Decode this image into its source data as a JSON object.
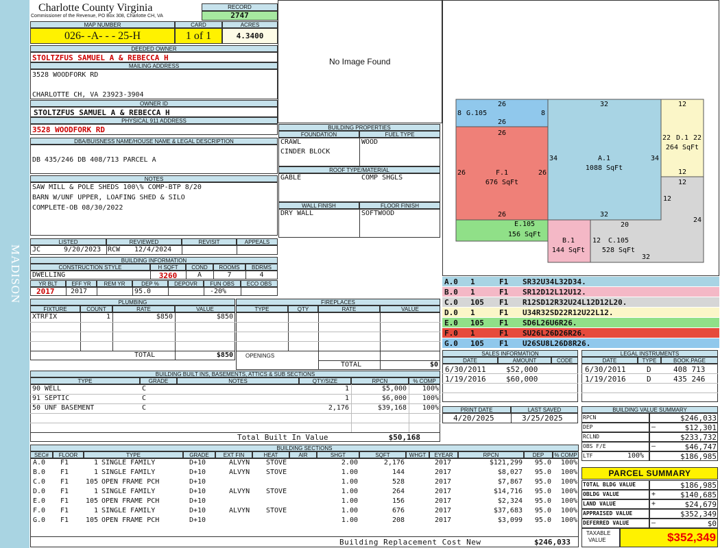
{
  "side_label": "MADISON",
  "header": {
    "county": "Charlotte County Virginia",
    "commissioner": "Commissioner of the Revenue, PO Box 308, Charlotte CH, VA",
    "record_label": "RECORD",
    "record": "2747"
  },
  "parcel": {
    "map_label": "MAP NUMBER",
    "map_number": "026- -A- - - 25-H",
    "card_label": "CARD",
    "card": "1 of 1",
    "acres_label": "ACRES",
    "acres": "4.3400"
  },
  "deeded_owner": {
    "label": "DEEDED OWNER",
    "value": "STOLTZFUS SAMUEL A & REBECCA H"
  },
  "mailing": {
    "label": "MAILING ADDRESS",
    "line1": "3528 WOODFORK RD",
    "line2": "CHARLOTTE CH, VA 23923-3904"
  },
  "owner_id": {
    "label": "OWNER ID",
    "value": "STOLTZFUS SAMUEL A & REBECCA H"
  },
  "physical": {
    "label": "PHYSICAL 911 ADDRESS",
    "value": "3528 WOODFORK RD"
  },
  "legal_desc": {
    "label": "DBA/BUISNESS NAME/HOUSE NAME & LEGAL DESCRIPTION",
    "value": "DB 435/246 DB 408/713 PARCEL A"
  },
  "notes": {
    "label": "NOTES",
    "lines": [
      "SAW MILL & POLE SHEDS 100\\% COMP-BTP 8/20",
      "BARN W/UNF UPPER, LOAFING SHED & SILO",
      "COMPLETE-OB 08/30/2022"
    ]
  },
  "image": {
    "no_image": "No Image Found"
  },
  "review": {
    "listed_label": "LISTED",
    "reviewed_label": "REVIEWED",
    "revisit_label": "REVISIT",
    "appeals_label": "APPEALS",
    "listed_by": "JC",
    "listed_date": "9/20/2023",
    "reviewed_by": "RCW",
    "reviewed_date": "12/4/2024"
  },
  "building_info": {
    "label": "BUILDING INFORMATION",
    "style_label": "CONSTRUCTION STYLE",
    "hsqft_label": "H SQFT",
    "cond_label": "COND",
    "rooms_label": "ROOMS",
    "bdrms_label": "BDRMS",
    "style": "DWELLING",
    "hsqft": "3260",
    "cond": "A",
    "rooms": "7",
    "bdrms": "4",
    "yrblt_label": "YR BLT",
    "effyr_label": "EFF YR",
    "remyr_label": "REM YR",
    "dep_label": "DEP %",
    "depovr_label": "DEPOVR",
    "funobs_label": "FUN OBS",
    "ecoobs_label": "ECO OBS",
    "yrblt": "2017",
    "effyr": "2017",
    "dep": "95.0",
    "funobs": "-20%"
  },
  "plumbing": {
    "label": "PLUMBING",
    "headers": [
      "FIXTURE",
      "COUNT",
      "RATE",
      "VALUE"
    ],
    "rows": [
      {
        "fixture": "XTRFIX",
        "count": "1",
        "rate": "$850",
        "value": "$850"
      }
    ],
    "total_label": "TOTAL",
    "total": "$850"
  },
  "fireplaces": {
    "label": "FIREPLACES",
    "headers": [
      "TYPE",
      "QTY",
      "RATE",
      "VALUE"
    ],
    "openings_label": "OPENINGS",
    "total_label": "TOTAL",
    "total": "$0"
  },
  "building_props": {
    "label": "BUILDING PROPERTIES",
    "foundation_label": "FOUNDATION",
    "fuel_label": "FUEL TYPE",
    "foundation": [
      "CRAWL",
      "CINDER BLOCK"
    ],
    "fuel": "WOOD",
    "roof_label": "ROOF TYPE/MATERIAL",
    "roof_type": "GABLE",
    "roof_material": "COMP SHGLS",
    "wall_label": "WALL FINISH",
    "floor_label": "FLOOR FINISH",
    "wall": "DRY WALL",
    "floor": "SOFTWOOD"
  },
  "sketch": {
    "areas": [
      {
        "id": "G",
        "name": "G.105",
        "sqft": "",
        "top": "26",
        "bottom": "26",
        "left": "8",
        "right": "8",
        "color": "#90c8ec"
      },
      {
        "id": "F",
        "name": "F.1",
        "sqft": "676 SqFt",
        "top": "26",
        "bottom": "26",
        "left": "26",
        "right": "26",
        "color": "#ef8078"
      },
      {
        "id": "A",
        "name": "A.1",
        "sqft": "1088 SqFt",
        "top": "32",
        "bottom": "32",
        "left": "34",
        "right": "34",
        "color": "#a8d4e4"
      },
      {
        "id": "D",
        "name": "D.1",
        "sqft": "264 SqFt",
        "top": "12",
        "bottom": "12",
        "left": "22",
        "right": "22",
        "color": "#fbf6c8"
      },
      {
        "id": "E",
        "name": "E.105",
        "sqft": "156 SqFt",
        "color": "#90e088"
      },
      {
        "id": "B",
        "name": "B.1",
        "sqft": "144 SqFt",
        "color": "#f4b8c6"
      },
      {
        "id": "C",
        "name": "C.105",
        "sqft": "528 SqFt",
        "t1": "12",
        "t2": "20",
        "l1": "12",
        "r1": "24",
        "b1": "12",
        "b2": "32",
        "color": "#d6d6d6"
      }
    ]
  },
  "vectors": [
    {
      "code": "A.0",
      "n": "1",
      "f": "F1",
      "path": "SR32U34L32D34.",
      "color": "#a8d4e4"
    },
    {
      "code": "B.0",
      "n": "1",
      "f": "F1",
      "path": "SR12D12L12U12.",
      "color": "#f4b8c6"
    },
    {
      "code": "C.0",
      "n": "105",
      "f": "F1",
      "path": "R12SD12R32U24L12D12L20.",
      "color": "#d6d6d6"
    },
    {
      "code": "D.0",
      "n": "1",
      "f": "F1",
      "path": "U34R32SD22R12U22L12.",
      "color": "#fbf6c8"
    },
    {
      "code": "E.0",
      "n": "105",
      "f": "F1",
      "path": "SD6L26U6R26.",
      "color": "#90e088"
    },
    {
      "code": "F.0",
      "n": "1",
      "f": "F1",
      "path": "SU26L26D26R26.",
      "color": "#e64a3c"
    },
    {
      "code": "G.0",
      "n": "105",
      "f": "F1",
      "path": "U26SU8L26D8R26.",
      "color": "#90c8ec"
    }
  ],
  "sales": {
    "label": "SALES INFORMATION",
    "headers": [
      "DATE",
      "AMOUNT",
      "CODE"
    ],
    "rows": [
      {
        "date": "6/30/2011",
        "amount": "$52,000"
      },
      {
        "date": "1/19/2016",
        "amount": "$60,000"
      }
    ]
  },
  "legal_instruments": {
    "label": "LEGAL INSTRUMENTS",
    "headers": [
      "DATE",
      "TYPE",
      "BOOK.PAGE"
    ],
    "rows": [
      {
        "date": "6/30/2011",
        "type": "D",
        "book": "408 713"
      },
      {
        "date": "1/19/2016",
        "type": "D",
        "book": "435 246"
      }
    ]
  },
  "print": {
    "print_label": "PRINT DATE",
    "saved_label": "LAST SAVED",
    "print_date": "4/20/2025",
    "last_saved": "3/25/2025"
  },
  "value_summary": {
    "label": "BUILDING VALUE SUMMARY",
    "rows": [
      {
        "label": "RPCN",
        "sign": "",
        "value": "$246,033"
      },
      {
        "label": "DEP",
        "sign": "–",
        "value": "$12,301"
      },
      {
        "label": "RCLND",
        "sign": "",
        "value": "$233,732"
      },
      {
        "label": "OBS F/E",
        "sign": "–",
        "value": "$46,747"
      },
      {
        "label": "LTF",
        "pct": "100%",
        "sign": "",
        "value": "$186,985"
      }
    ]
  },
  "parcel_summary": {
    "label": "PARCEL SUMMARY",
    "rows": [
      {
        "label": "TOTAL BLDG VALUE",
        "sign": "",
        "value": "$186,985"
      },
      {
        "label": "OBLDG VALUE",
        "sign": "+",
        "value": "$140,685"
      },
      {
        "label": "LAND VALUE",
        "sign": "+",
        "value": "$24,679"
      },
      {
        "label": "APPRAISED VALUE",
        "sign": "",
        "value": "$352,349"
      },
      {
        "label": "DEFERRED VALUE",
        "sign": "–",
        "value": "$0"
      }
    ],
    "taxable_label1": "TAXABLE",
    "taxable_label2": "VALUE",
    "taxable": "$352,349"
  },
  "builtins": {
    "label": "BUILDING BUILT INS, BASEMENTS, ATTICS & SUB SECTIONS",
    "headers": [
      "TYPE",
      "GRADE",
      "NOTES",
      "QTY/SIZE",
      "RPCN",
      "% COMP"
    ],
    "rows": [
      {
        "type": "90 WELL",
        "grade": "C",
        "qty": "1",
        "rpcn": "$5,000",
        "comp": "100%"
      },
      {
        "type": "91 SEPTIC",
        "grade": "C",
        "qty": "1",
        "rpcn": "$6,000",
        "comp": "100%"
      },
      {
        "type": "50 UNF BASEMENT",
        "grade": "C",
        "qty": "2,176",
        "rpcn": "$39,168",
        "comp": "100%"
      }
    ],
    "total_label": "Total Built In Value",
    "total": "$50,168"
  },
  "sections": {
    "label": "BUILDING SECTIONS",
    "headers": [
      "SEC#",
      "FLOOR",
      "TYPE",
      "GRADE",
      "EXT FIN",
      "HEAT",
      "AIR",
      "SHGT",
      "SQFT",
      "WHGT",
      "EYEAR",
      "RPCN",
      "DEP",
      "% COMP"
    ],
    "rows": [
      {
        "sec": "A.0",
        "floor": "F1",
        "code": "1",
        "type": "SINGLE FAMILY",
        "grade": "D+10",
        "ext": "ALVYN",
        "heat": "STOVE",
        "shgt": "2.00",
        "sqft": "2,176",
        "eyear": "2017",
        "rpcn": "$121,299",
        "dep": "95.0",
        "comp": "100%"
      },
      {
        "sec": "B.0",
        "floor": "F1",
        "code": "1",
        "type": "SINGLE FAMILY",
        "grade": "D+10",
        "ext": "ALVYN",
        "heat": "STOVE",
        "shgt": "1.00",
        "sqft": "144",
        "eyear": "2017",
        "rpcn": "$8,027",
        "dep": "95.0",
        "comp": "100%"
      },
      {
        "sec": "C.0",
        "floor": "F1",
        "code": "105",
        "type": "OPEN FRAME PCH",
        "grade": "D+10",
        "ext": "",
        "heat": "",
        "shgt": "1.00",
        "sqft": "528",
        "eyear": "2017",
        "rpcn": "$7,867",
        "dep": "95.0",
        "comp": "100%"
      },
      {
        "sec": "D.0",
        "floor": "F1",
        "code": "1",
        "type": "SINGLE FAMILY",
        "grade": "D+10",
        "ext": "ALVYN",
        "heat": "STOVE",
        "shgt": "1.00",
        "sqft": "264",
        "eyear": "2017",
        "rpcn": "$14,716",
        "dep": "95.0",
        "comp": "100%"
      },
      {
        "sec": "E.0",
        "floor": "F1",
        "code": "105",
        "type": "OPEN FRAME PCH",
        "grade": "D+10",
        "ext": "",
        "heat": "",
        "shgt": "1.00",
        "sqft": "156",
        "eyear": "2017",
        "rpcn": "$2,324",
        "dep": "95.0",
        "comp": "100%"
      },
      {
        "sec": "F.0",
        "floor": "F1",
        "code": "1",
        "type": "SINGLE FAMILY",
        "grade": "D+10",
        "ext": "ALVYN",
        "heat": "STOVE",
        "shgt": "1.00",
        "sqft": "676",
        "eyear": "2017",
        "rpcn": "$37,683",
        "dep": "95.0",
        "comp": "100%"
      },
      {
        "sec": "G.0",
        "floor": "F1",
        "code": "105",
        "type": "OPEN FRAME PCH",
        "grade": "D+10",
        "ext": "",
        "heat": "",
        "shgt": "1.00",
        "sqft": "208",
        "eyear": "2017",
        "rpcn": "$3,099",
        "dep": "95.0",
        "comp": "100%"
      }
    ],
    "total_label": "Building Replacement Cost New",
    "total": "$246,033"
  }
}
